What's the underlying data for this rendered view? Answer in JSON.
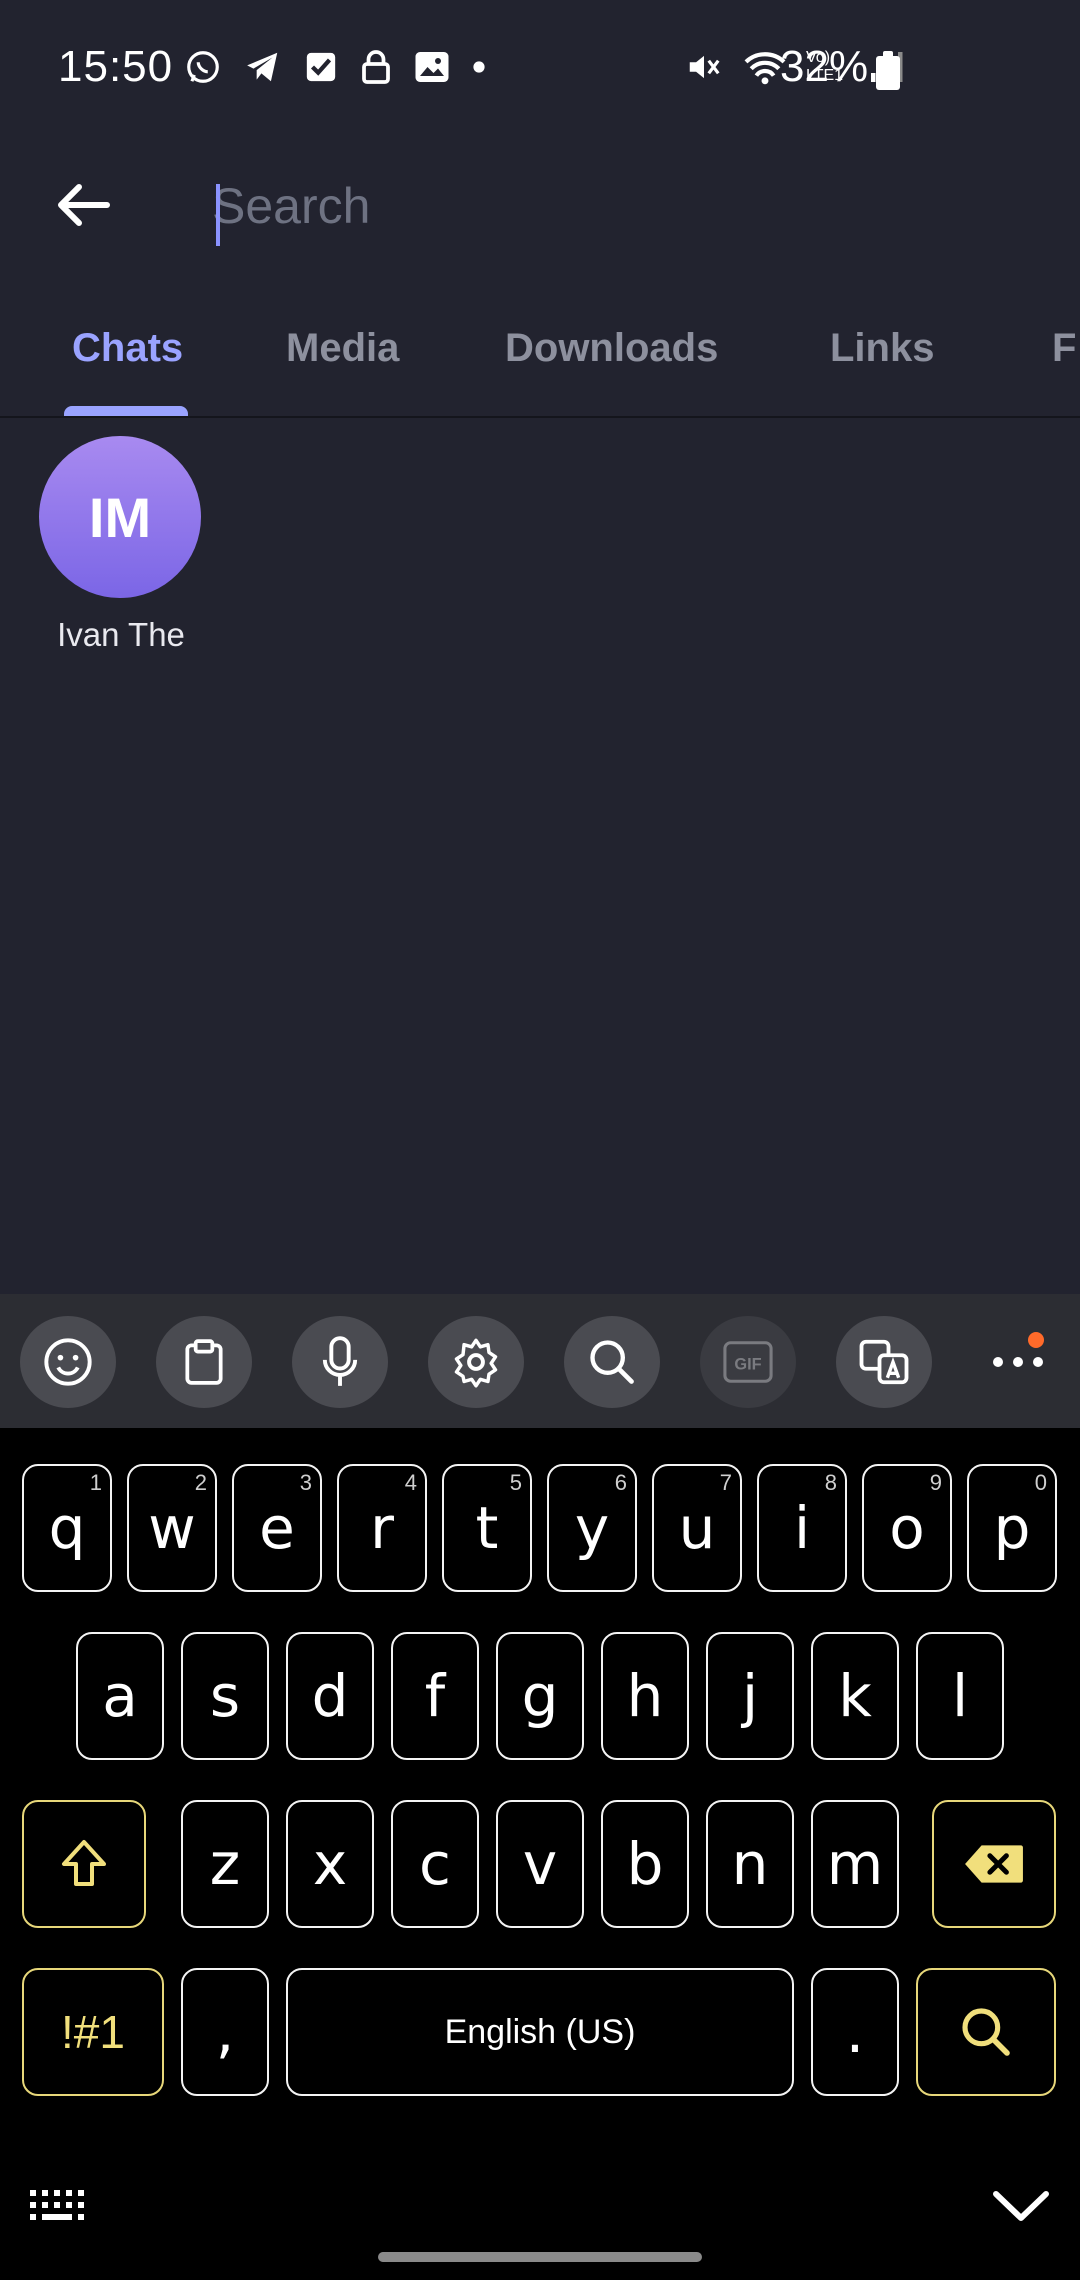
{
  "status_bar": {
    "time": "15:50",
    "left_icons": [
      "whatsapp-icon",
      "telegram-icon",
      "checkbox-icon",
      "lock-icon",
      "image-icon",
      "dot-icon"
    ],
    "right_icons": [
      "mute-icon",
      "wifi-icon",
      "volte-lte-icon",
      "signal-icon"
    ],
    "network_label": "Vo) LTE1",
    "battery_percent": "32%"
  },
  "search": {
    "placeholder": "Search",
    "value": ""
  },
  "tabs": [
    {
      "label": "Chats",
      "active": true
    },
    {
      "label": "Media",
      "active": false
    },
    {
      "label": "Downloads",
      "active": false
    },
    {
      "label": "Links",
      "active": false
    },
    {
      "label": "F",
      "active": false
    }
  ],
  "contacts": [
    {
      "initials": "IM",
      "name": "Ivan The"
    }
  ],
  "keyboard": {
    "toolbar": [
      "emoji-icon",
      "clipboard-icon",
      "microphone-icon",
      "settings-icon",
      "search-icon",
      "gif-icon",
      "translate-icon",
      "more-icon"
    ],
    "gif_label": "GIF",
    "row1": [
      {
        "key": "q",
        "sup": "1"
      },
      {
        "key": "w",
        "sup": "2"
      },
      {
        "key": "e",
        "sup": "3"
      },
      {
        "key": "r",
        "sup": "4"
      },
      {
        "key": "t",
        "sup": "5"
      },
      {
        "key": "y",
        "sup": "6"
      },
      {
        "key": "u",
        "sup": "7"
      },
      {
        "key": "i",
        "sup": "8"
      },
      {
        "key": "o",
        "sup": "9"
      },
      {
        "key": "p",
        "sup": "0"
      }
    ],
    "row2": [
      "a",
      "s",
      "d",
      "f",
      "g",
      "h",
      "j",
      "k",
      "l"
    ],
    "row3": [
      "z",
      "x",
      "c",
      "v",
      "b",
      "n",
      "m"
    ],
    "symbols_label": "!#1",
    "comma_label": ",",
    "space_label": "English (US)",
    "period_label": "."
  },
  "colors": {
    "background": "#22232f",
    "accent": "#9aa3ff",
    "keyboard_func": "#f1df7c"
  }
}
